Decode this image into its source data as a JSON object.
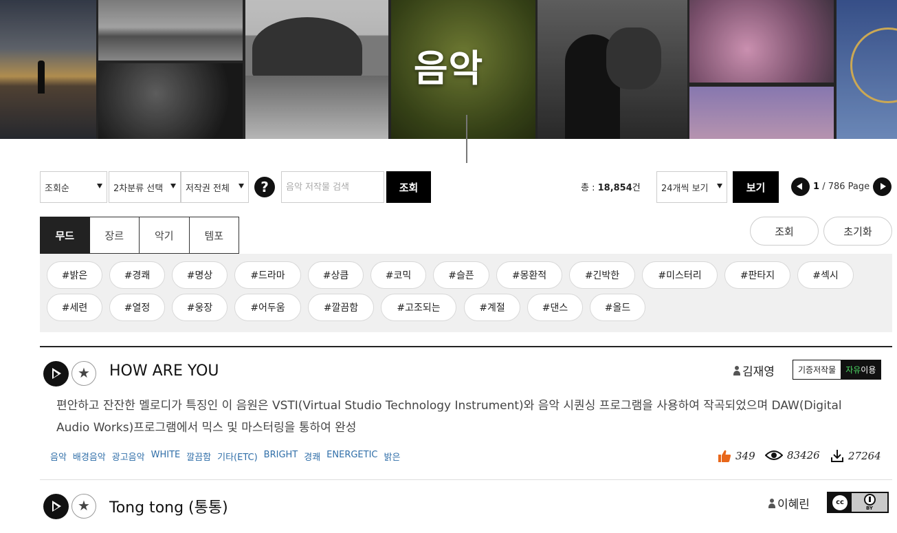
{
  "page": {
    "title": "음악"
  },
  "toolbar": {
    "sort": "조회순",
    "category": "2차분류 선택",
    "license": "저작권 전체",
    "help_glyph": "?",
    "search_placeholder": "음악 저작물 검색",
    "search_button": "조회",
    "total_label": "총 : ",
    "total_count": "18,854",
    "total_unit": "건",
    "per_page": "24개씩 보기",
    "view_button": "보기",
    "current_page": "1",
    "total_pages": "/ 786 Page"
  },
  "filter_tabs": [
    {
      "label": "무드",
      "active": true
    },
    {
      "label": "장르",
      "active": false
    },
    {
      "label": "악기",
      "active": false
    },
    {
      "label": "템포",
      "active": false
    }
  ],
  "actions": {
    "search": "조회",
    "reset": "초기화"
  },
  "mood_tags": [
    "#밝은",
    "#경쾌",
    "#명상",
    "#드라마",
    "#상큼",
    "#코믹",
    "#슬픈",
    "#몽환적",
    "#긴박한",
    "#미스터리",
    "#판타지",
    "#섹시",
    "#세련",
    "#열정",
    "#웅장",
    "#어두움",
    "#깔끔함",
    "#고조되는",
    "#계절",
    "#댄스",
    "#올드"
  ],
  "tracks": [
    {
      "title": "HOW ARE YOU",
      "author": "김재영",
      "badge_left": "기증저작물",
      "badge_free": "자유",
      "badge_use": "이용",
      "description": "편안하고 잔잔한 멜로디가 특징인 이 음원은 VSTI(Virtual Studio Technology Instrument)와 음악 시퀀싱 프로그램을 사용하여 작곡되었으며 DAW(Digital Audio Works)프로그램에서 믹스 및 마스터링을 통하여 완성",
      "keywords": [
        "음악",
        "배경음악",
        "광고음악",
        "WHITE",
        "깔끔함",
        "기타(ETC)",
        "BRIGHT",
        "경쾌",
        "ENERGETIC",
        "밝은"
      ],
      "likes": "349",
      "views": "83426",
      "downloads": "27264"
    },
    {
      "title": "Tong tong (통통)",
      "author": "이혜린",
      "license_icon": "cc-by-icon",
      "cc_text": "BY"
    }
  ],
  "colors": {
    "keyword_link": "#2f6ea8",
    "like_icon": "#e8671b",
    "free_text": "#4cd964"
  }
}
